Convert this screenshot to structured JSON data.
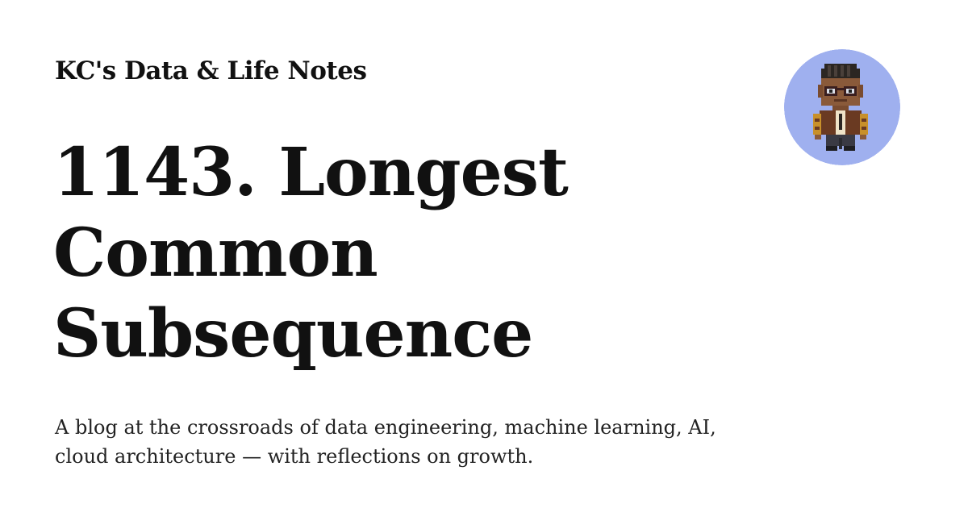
{
  "site": {
    "name": "KC's Data & Life Notes"
  },
  "post": {
    "title": "1143. Longest Common Subsequence",
    "description": "A blog at the crossroads of data engineering, machine learning, AI, cloud architecture — with reflections on growth."
  },
  "avatar": {
    "icon": "pixel-art-person-avatar-icon",
    "background_color": "#9fb0ef"
  }
}
